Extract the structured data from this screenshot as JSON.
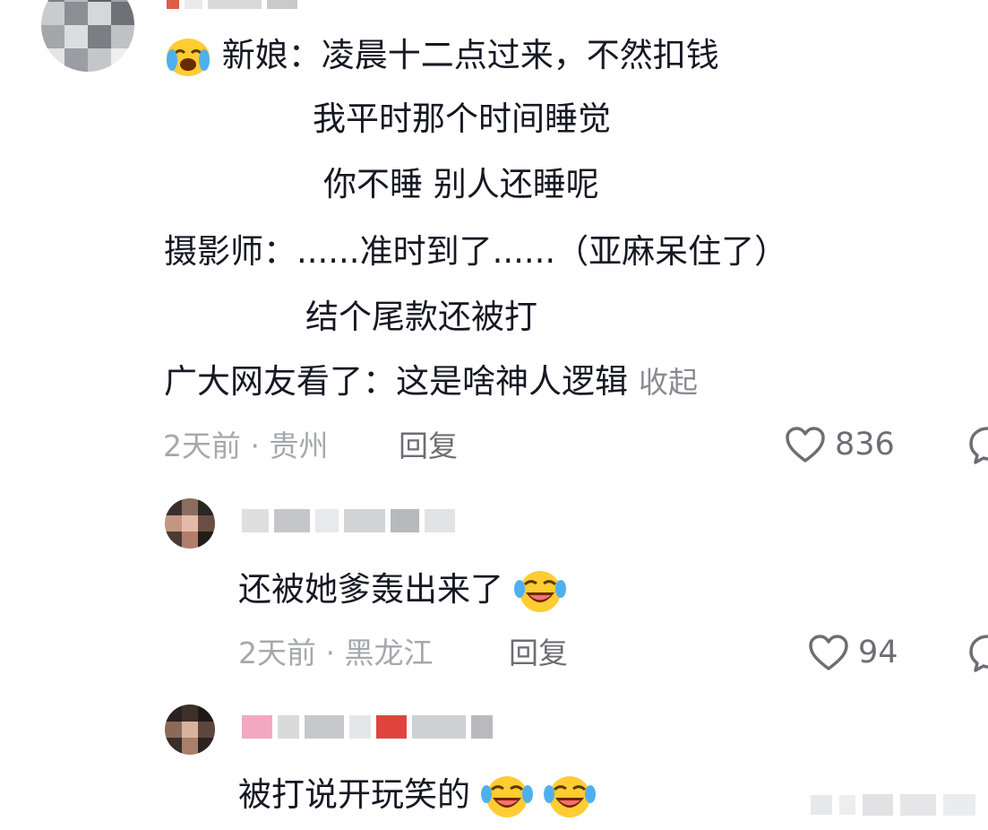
{
  "comments": [
    {
      "lines": [
        "新娘：凌晨十二点过来，不然扣钱",
        "我平时那个时间睡觉",
        "你不睡 别人还睡呢",
        "摄影师：......准时到了......（亚麻呆住了）",
        "结个尾款还被打",
        "广大网友看了：这是啥神人逻辑"
      ],
      "collapse_label": "收起",
      "meta": "2天前 · 贵州",
      "reply_label": "回复",
      "likes": "836"
    },
    {
      "text": "还被她爹轰出来了",
      "meta": "2天前 · 黑龙江",
      "reply_label": "回复",
      "likes": "94"
    },
    {
      "text": "被打说开玩笑的"
    }
  ],
  "icons": {
    "crying": "loudly-crying-face-icon",
    "laughing": "rolling-laughing-face-icon",
    "like": "heart-outline-icon",
    "comment": "comment-bubble-icon"
  },
  "colors": {
    "text": "#161823",
    "meta": "#a7a8ac",
    "action": "#6d6e73",
    "emoji_yellow": "#ffcc33"
  }
}
